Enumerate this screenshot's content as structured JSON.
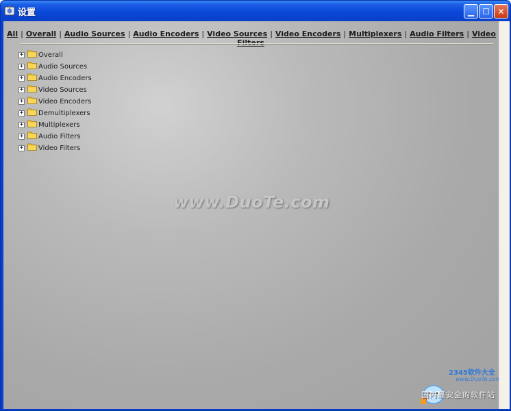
{
  "window": {
    "title": "设置",
    "buttons": {
      "minimize": "▁",
      "maximize": "☐",
      "close": "✕"
    }
  },
  "nav": {
    "links": [
      "All",
      "Overall",
      "Audio Sources",
      "Audio Encoders",
      "Video Sources",
      "Video Encoders",
      "Multiplexers",
      "Audio Filters",
      "Video Filters"
    ],
    "separator": "|"
  },
  "tree": {
    "expander": "+",
    "items": [
      "Overall",
      "Audio Sources",
      "Audio Encoders",
      "Video Sources",
      "Video Encoders",
      "Demultiplexers",
      "Multiplexers",
      "Audio Filters",
      "Video Filters"
    ]
  },
  "watermark": {
    "text": "www.DuoTe.com"
  },
  "corner_logo": {
    "brand": "2345软件大全",
    "url": "www.DuoTe.com",
    "slogan": "国内最安全的软件站"
  },
  "colors": {
    "titlebar": "#0a48d8",
    "content_bg": "#a9a9a9",
    "folder": "#f2c12e"
  }
}
